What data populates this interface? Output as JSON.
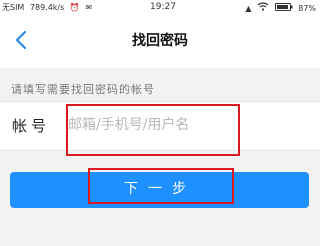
{
  "status_bar": {
    "carrier": "无SIM",
    "network_speed": "789.4k/s",
    "time": "19:27",
    "battery_level": "87%",
    "icons": [
      "clock-icon",
      "notification-icon",
      "signal-icon",
      "wifi-icon",
      "battery-icon"
    ]
  },
  "nav": {
    "title": "找回密码",
    "back_icon": "chevron-left-icon"
  },
  "form": {
    "hint": "请填写需要找回密码的帐号",
    "account_label": "帐号",
    "account_value": "",
    "account_placeholder": "邮箱/手机号/用户名",
    "next_label": "下一步"
  },
  "colors": {
    "accent": "#1e90ff",
    "highlight_border": "#d9191f",
    "page_background": "#f2f2f2"
  }
}
